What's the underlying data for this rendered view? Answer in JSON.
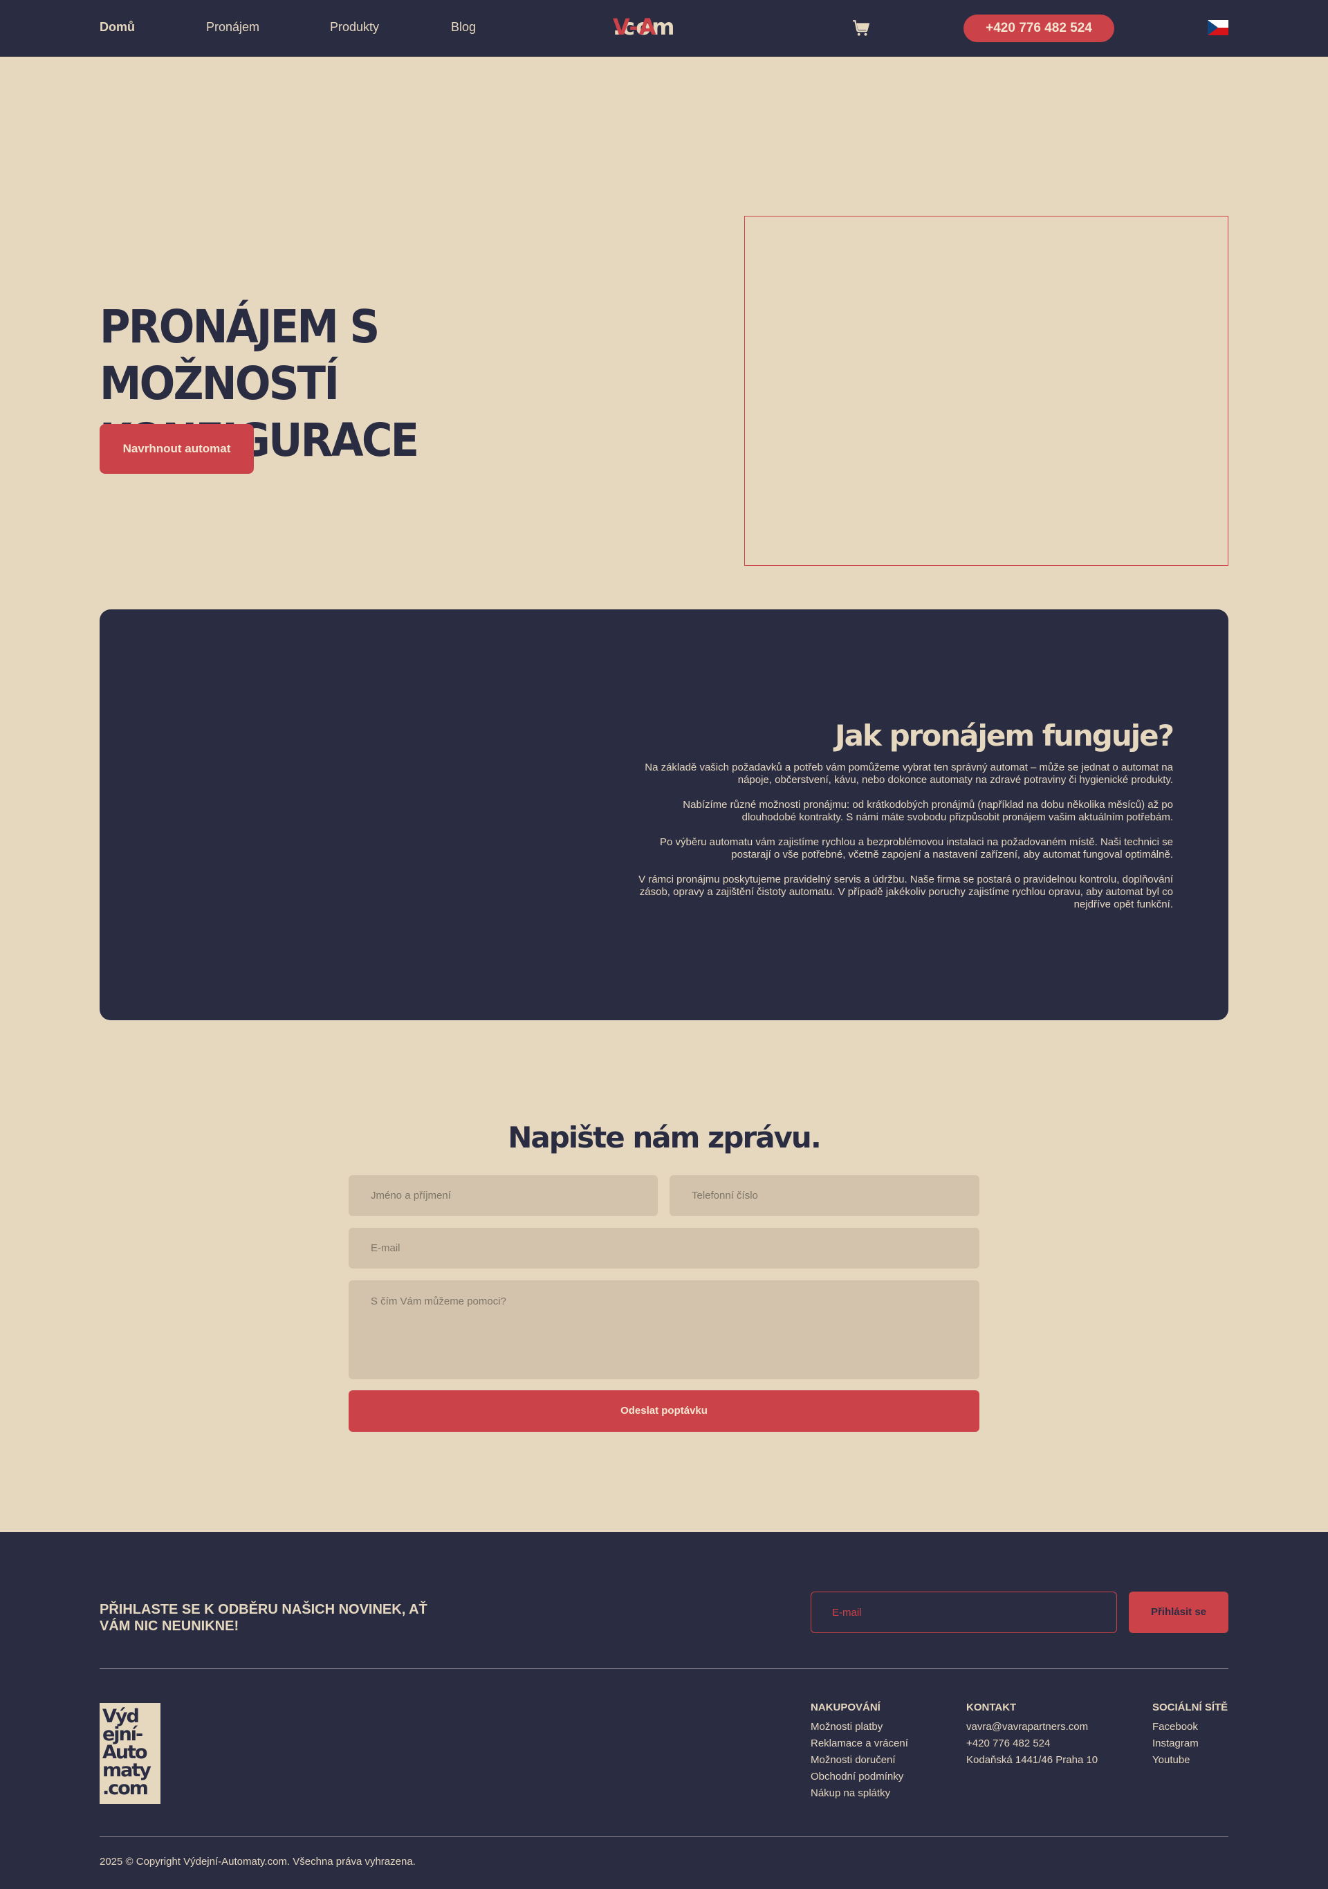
{
  "nav": {
    "links": [
      "Domů",
      "Pronájem",
      "Produkty",
      "Blog"
    ],
    "logo": {
      "part1": "V-A",
      "part2": ".com"
    },
    "phone": "+420 776 482 524",
    "cart_icon": "shopping-cart-icon",
    "language_icon": "czech-flag-icon"
  },
  "hero": {
    "title_line1": "PRONÁJEM S MOŽNOSTÍ",
    "title_line2": "KONFIGURACE",
    "button": "Navrhnout automat"
  },
  "how": {
    "title": "Jak pronájem funguje?",
    "paragraphs": [
      "Na základě vašich požadavků a potřeb vám pomůžeme vybrat ten správný automat – může se jednat o automat na nápoje, občerstvení, kávu, nebo dokonce automaty na zdravé potraviny či hygienické produkty.",
      "Nabízíme různé možnosti pronájmu: od krátkodobých pronájmů (například na dobu několika měsíců) až po dlouhodobé kontrakty. S námi máte svobodu přizpůsobit pronájem vašim aktuálním potřebám.",
      "Po výběru automatu vám zajistíme rychlou a bezproblémovou instalaci na požadovaném místě. Naši technici se postarají o vše potřebné, včetně zapojení a nastavení zařízení, aby automat fungoval optimálně.",
      "V rámci pronájmu poskytujeme pravidelný servis a údržbu. Naše firma se postará o pravidelnou kontrolu, doplňování zásob, opravy a zajištění čistoty automatu. V případě jakékoliv poruchy zajistíme rychlou opravu, aby automat byl co nejdříve opět funkční."
    ]
  },
  "contact": {
    "title": "Napište nám zprávu.",
    "name_placeholder": "Jméno a příjmení",
    "phone_placeholder": "Telefonní číslo",
    "email_placeholder": "E-mail",
    "message_placeholder": "S čím Vám můžeme pomoci?",
    "submit": "Odeslat poptávku"
  },
  "footer": {
    "newsletter_text": "PŘIHLASTE SE K ODBĚRU NAŠICH NOVINEK, AŤ VÁM NIC NEUNIKNE!",
    "newsletter_placeholder": "E-mail",
    "newsletter_button": "Přihlásit se",
    "logo_text": "Výdejní-Automaty.com",
    "columns": {
      "shopping": {
        "title": "NAKUPOVÁNÍ",
        "items": [
          "Možnosti platby",
          "Reklamace a vrácení",
          "Možnosti doručení",
          "Obchodní podmínky",
          "Nákup na splátky"
        ]
      },
      "contact": {
        "title": "KONTAKT",
        "items": [
          "vavra@vavrapartners.com",
          "+420 776 482 524",
          "Kodaňská 1441/46 Praha 10"
        ]
      },
      "social": {
        "title": "SOCIÁLNÍ SÍTĚ",
        "items": [
          "Facebook",
          "Instagram",
          "Youtube"
        ]
      }
    },
    "copyright": "2025 © Copyright Výdejní-Automaty.com. Všechna práva vyhrazena."
  },
  "colors": {
    "background": "#e6d7bf",
    "navy": "#2a2c42",
    "accent": "#cc4249",
    "field": "#d3c3ad"
  }
}
